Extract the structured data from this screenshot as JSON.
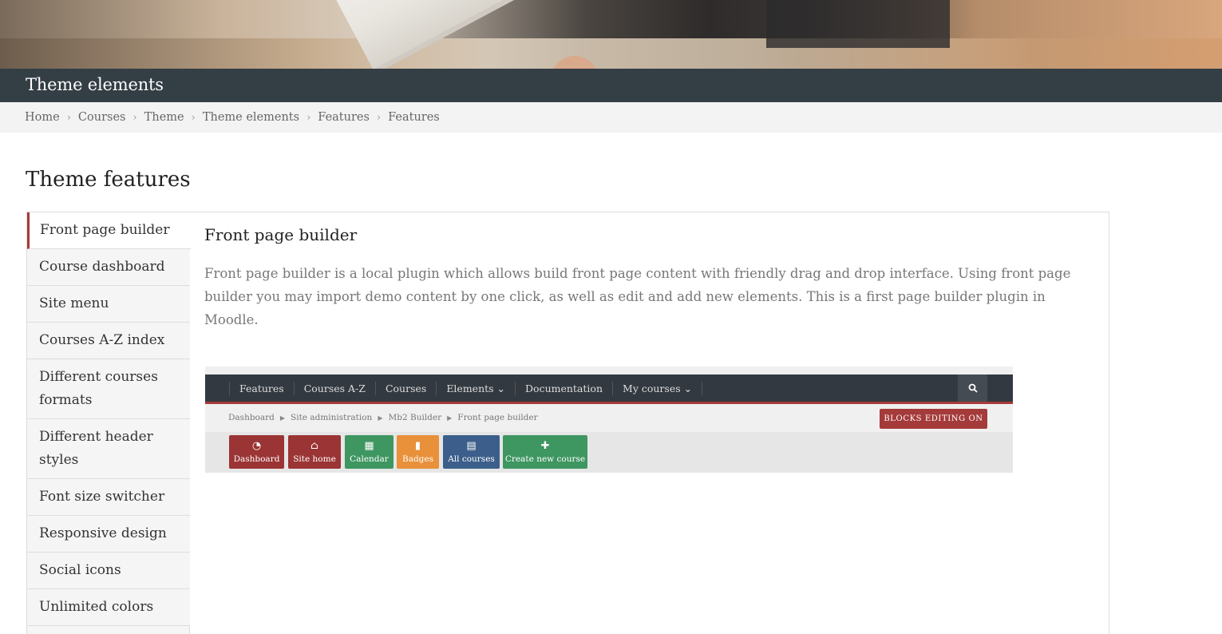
{
  "header": {
    "title": "Theme elements"
  },
  "breadcrumb": [
    "Home",
    "Courses",
    "Theme",
    "Theme elements",
    "Features",
    "Features"
  ],
  "section_title": "Theme features",
  "tabs": [
    "Front page builder",
    "Course dashboard",
    "Site menu",
    "Courses A-Z index",
    "Different courses formats",
    "Different header styles",
    "Font size switcher",
    "Responsive design",
    "Social icons",
    "Unlimited colors"
  ],
  "active_tab": "Front page builder",
  "content": {
    "heading": "Front page builder",
    "text": "Front page builder is a local plugin which allows build front page content with friendly drag and drop interface. Using front page builder you may import demo content by one click, as well as edit and add new elements. This is a first page builder plugin in Moodle."
  },
  "screenshot": {
    "nav": [
      "Features",
      "Courses A-Z",
      "Courses",
      "Elements ⌄",
      "Documentation",
      "My courses ⌄"
    ],
    "breadcrumb": [
      "Dashboard",
      "Site administration",
      "Mb2 Builder",
      "Front page builder"
    ],
    "edit_button": "BLOCKS EDITING ON",
    "buttons": [
      {
        "label": "Dashboard",
        "icon": "dashboard-icon",
        "color": "#9b3434"
      },
      {
        "label": "Site home",
        "icon": "home-icon",
        "color": "#9b3434"
      },
      {
        "label": "Calendar",
        "icon": "calendar-icon",
        "color": "#3e9660"
      },
      {
        "label": "Badges",
        "icon": "bookmark-icon",
        "color": "#e9903a"
      },
      {
        "label": "All courses",
        "icon": "book-icon",
        "color": "#3b5f8a"
      },
      {
        "label": "Create new course",
        "icon": "plus-icon",
        "color": "#3e9660"
      }
    ]
  },
  "colors": {
    "accent": "#a53a3a",
    "dark": "#343e45"
  }
}
